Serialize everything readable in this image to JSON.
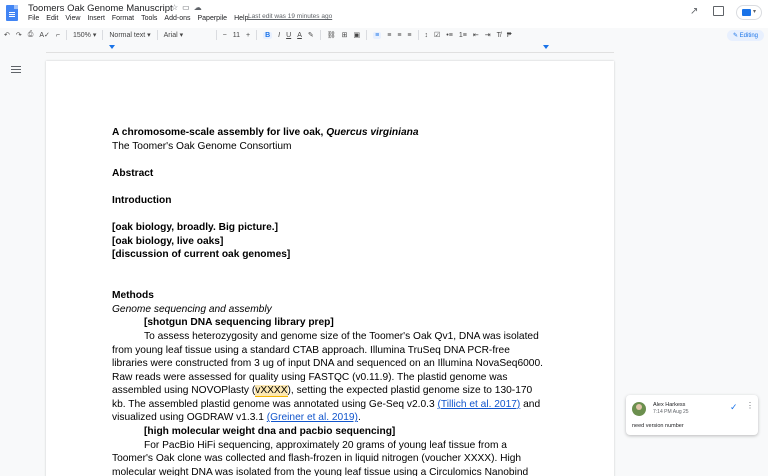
{
  "doc": {
    "title": "Toomers Oak Genome Manuscript",
    "last_edit": "Last edit was 19 minutes ago"
  },
  "menu": [
    "File",
    "Edit",
    "View",
    "Insert",
    "Format",
    "Tools",
    "Add-ons",
    "Paperpile",
    "Help"
  ],
  "toolbar": {
    "zoom": "150%",
    "style": "Normal text",
    "font": "Arial",
    "font_size": "11",
    "bold": "B",
    "italic": "I",
    "underline": "U",
    "text_color": "A",
    "editing": "Editing"
  },
  "body": {
    "title_prefix": "A chromosome-scale assembly for live oak, ",
    "title_species": "Quercus virginiana",
    "consortium": "The Toomer's Oak Genome Consortium",
    "abstract": "Abstract",
    "introduction": "Introduction",
    "intro_1": "[oak biology, broadly. Big picture.]",
    "intro_2": "[oak biology, live oaks]",
    "intro_3": "[discussion of current oak genomes]",
    "methods": "Methods",
    "subsection": "Genome sequencing and assembly",
    "shotgun_heading": "[shotgun DNA sequencing library prep]",
    "p1_l1": "To assess heterozygosity and genome size of the Toomer's Oak Qv1, DNA was isolated",
    "p1_l2": "from young leaf tissue using a standard CTAB approach. Illumina TruSeq DNA PCR-free",
    "p1_l3": "libraries were constructed from 3 ug of input DNA and sequenced on an Illumina NovaSeq6000.",
    "p1_l4": "Raw reads were assessed for quality using FASTQC (v0.11.9). The plastid genome was",
    "p1_l5_a": "assembled using NOVOPlasty (",
    "p1_l5_hl": "vXXXX",
    "p1_l5_b": "), setting the expected plastid genome size to 130-170",
    "p1_l6_a": "kb. The assembled plastid genome was annotated using Ge-Seq v2.0.3 ",
    "p1_l6_link": "(Tillich et al. 2017)",
    "p1_l6_b": " and",
    "p1_l7_a": "visualized using OGDRAW v1.3.1 ",
    "p1_l7_link": "(Greiner et al. 2019)",
    "p1_l7_b": ".",
    "hmw_heading": "[high molecular weight dna and pacbio sequencing]",
    "p2_l1": "For PacBio HiFi sequencing, approximately 20 grams of young leaf tissue from a",
    "p2_l2": "Toomer's Oak clone was collected and flash-frozen in liquid nitrogen (voucher XXXX). High",
    "p2_l3": "molecular weight DNA was isolated from the young leaf tissue using a Circulomics Nanobind"
  },
  "comment": {
    "author": "Alex Harkess",
    "time": "7:14 PM Aug 25",
    "text": "need version number"
  },
  "colors": {
    "accent": "#1a73e8",
    "link": "#1155cc",
    "highlight": "#fce8b2"
  }
}
